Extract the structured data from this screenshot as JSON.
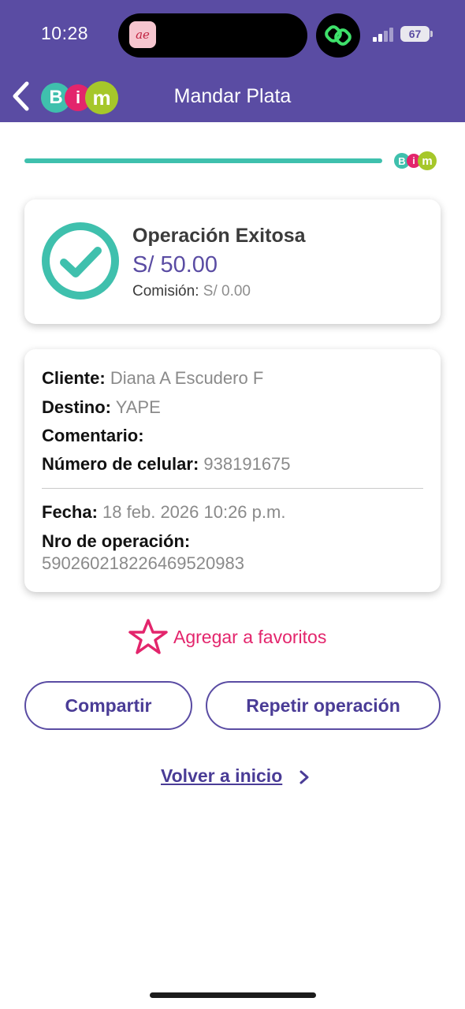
{
  "status_bar": {
    "time": "10:28",
    "battery": "67"
  },
  "header": {
    "title": "Mandar Plata",
    "logo_letters": [
      "B",
      "i",
      "m"
    ]
  },
  "colors": {
    "header": "#5a4ca3",
    "progress": "#3fc0ad",
    "success": "#3fc0ad",
    "favorite": "#e3256c",
    "accent": "#5a4ca3"
  },
  "progress": {
    "value": 1.0
  },
  "result": {
    "title": "Operación Exitosa",
    "amount": "S/ 50.00",
    "fee_label": "Comisión:",
    "fee_value": "S/ 0.00"
  },
  "details": {
    "client_label": "Cliente:",
    "client_value": "Diana A Escudero F",
    "destination_label": "Destino:",
    "destination_value": "YAPE",
    "comment_label": "Comentario:",
    "comment_value": "",
    "phone_label": "Número de celular:",
    "phone_value": "938191675",
    "date_label": "Fecha:",
    "date_value": "18 feb. 2026 10:26 p.m.",
    "op_number_label": "Nro de operación:",
    "op_number_value": "590260218226469520983"
  },
  "actions": {
    "favorite_label": "Agregar a favoritos",
    "share_label": "Compartir",
    "repeat_label": "Repetir operación",
    "home_label": "Volver a inicio"
  },
  "icons": {
    "back": "chevron-left-icon",
    "check": "check-circle-icon",
    "star": "star-outline-icon",
    "chevron": "chevron-right-icon"
  }
}
